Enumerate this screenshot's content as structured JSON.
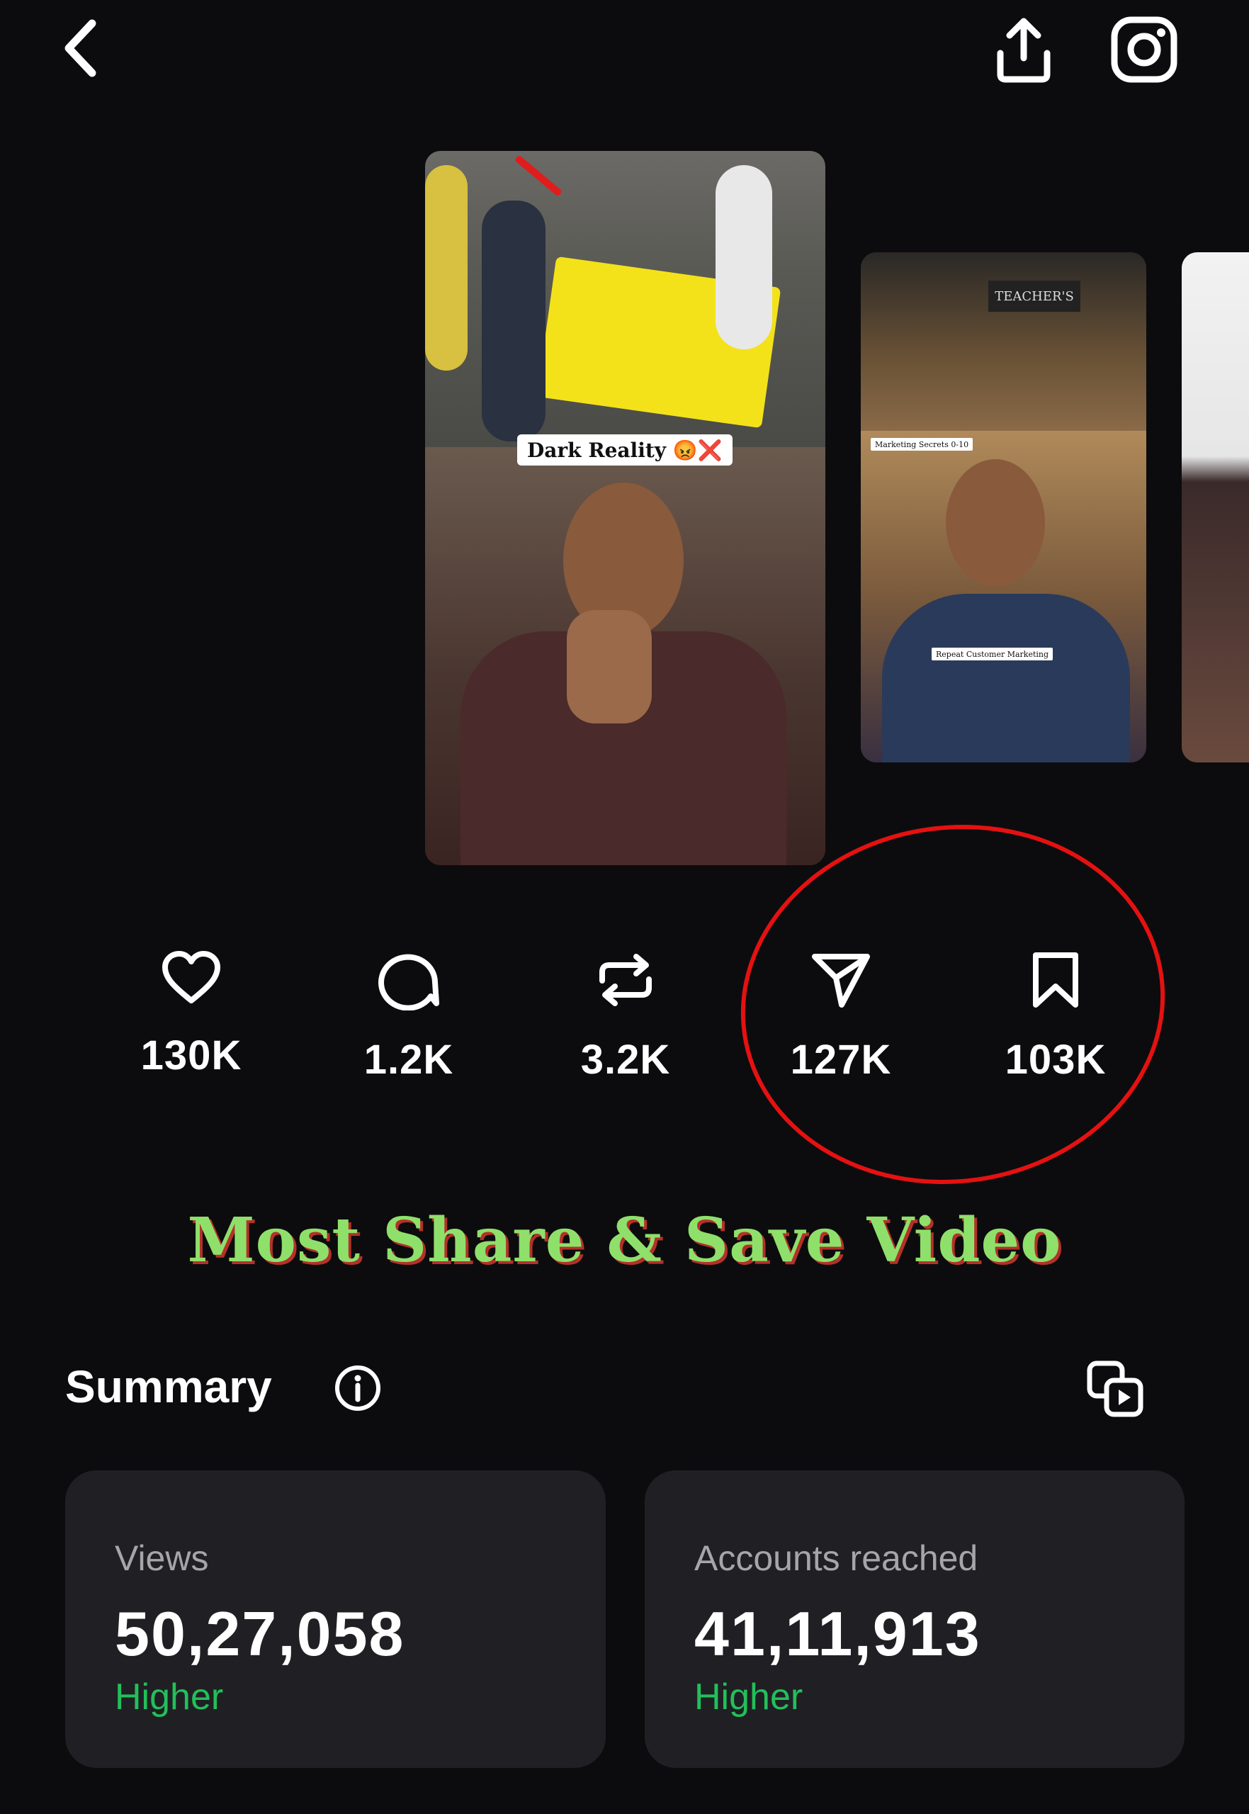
{
  "header": {
    "back_icon": "chevron-left-icon",
    "share_icon": "upload-icon",
    "instagram_icon": "instagram-icon"
  },
  "thumbnails": {
    "main_caption": "Dark Reality 😡❌",
    "second_caption_top": "Marketing Secrets 0-10",
    "second_caption_bottom": "Repeat Customer Marketing",
    "second_store_sign": "TEACHER'S"
  },
  "stats": [
    {
      "icon": "heart-icon",
      "value": "130K"
    },
    {
      "icon": "comment-icon",
      "value": "1.2K"
    },
    {
      "icon": "repost-icon",
      "value": "3.2K"
    },
    {
      "icon": "send-icon",
      "value": "127K"
    },
    {
      "icon": "bookmark-icon",
      "value": "103K"
    }
  ],
  "promo_title": "Most Share & Save Video",
  "summary": {
    "title": "Summary",
    "info_icon": "info-icon",
    "copy_icon": "copy-media-icon",
    "cards": [
      {
        "label": "Views",
        "value": "50,27,058",
        "delta": "Higher"
      },
      {
        "label": "Accounts reached",
        "value": "41,11,913",
        "delta": "Higher"
      }
    ]
  },
  "colors": {
    "background": "#0c0c0e",
    "card": "#202024",
    "positive": "#22c05a",
    "annotation": "#e51111",
    "promo_text": "#8fe06a"
  }
}
